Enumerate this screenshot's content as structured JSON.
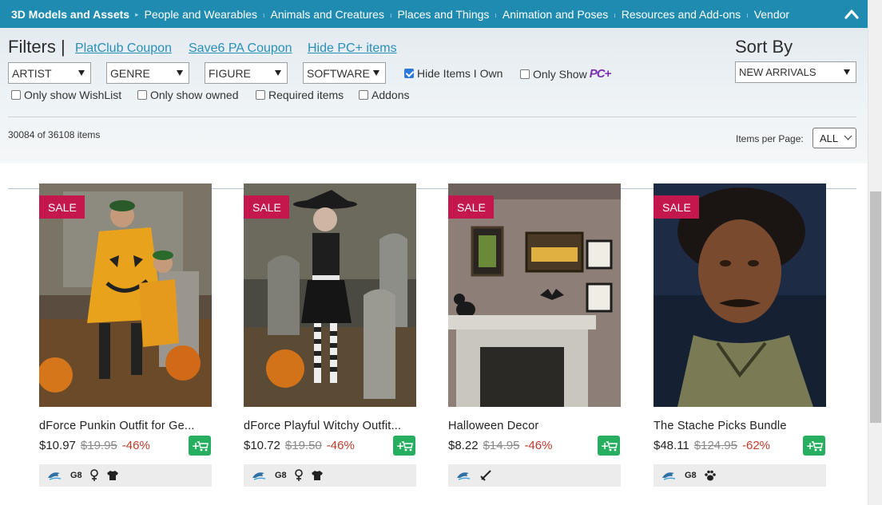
{
  "nav": {
    "items": [
      "3D Models and Assets",
      "People and Wearables",
      "Animals and Creatures",
      "Places and Things",
      "Animation and Poses",
      "Resources and Add-ons",
      "Vendor"
    ],
    "separator": "▸",
    "collapse_icon": "chevron-up-icon"
  },
  "filters": {
    "title": "Filters |",
    "links": [
      "PlatClub Coupon",
      "Save6 PA Coupon",
      "Hide PC+ items"
    ],
    "selects": [
      "ARTIST",
      "GENRE",
      "FIGURE",
      "SOFTWARE"
    ],
    "hide_owned": {
      "label": "Hide Items I Own",
      "checked": true
    },
    "only_show": {
      "label": "Only Show",
      "badge": "PC+",
      "checked": false
    },
    "checks": [
      {
        "label": "Only show WishList",
        "checked": false
      },
      {
        "label": "Only show owned",
        "checked": false
      },
      {
        "label": "Required items",
        "checked": false
      },
      {
        "label": "Addons",
        "checked": false
      }
    ],
    "sort_label": "Sort By",
    "sort_value": "NEW ARRIVALS"
  },
  "results": {
    "count_text": "30084 of 36108 items",
    "per_page_label": "Items per Page:",
    "per_page_value": "ALL"
  },
  "colors": {
    "nav": "#1f8bb0",
    "sale": "#c3174e",
    "cart": "#27ae60",
    "link": "#2a8fb8",
    "discount": "#c0392b"
  },
  "products": [
    {
      "badge": "SALE",
      "title": "dForce Punkin Outfit for Ge...",
      "price": "$10.97",
      "old_price": "$19.95",
      "discount": "-46%",
      "tags": {
        "figure": "G8",
        "icons": [
          "daz-dolphin-icon",
          "female-icon",
          "clothing-icon"
        ]
      }
    },
    {
      "badge": "SALE",
      "title": "dForce Playful Witchy Outfit...",
      "price": "$10.72",
      "old_price": "$19.50",
      "discount": "-46%",
      "tags": {
        "figure": "G8",
        "icons": [
          "daz-dolphin-icon",
          "female-icon",
          "clothing-icon"
        ]
      }
    },
    {
      "badge": "SALE",
      "title": "Halloween Decor",
      "price": "$8.22",
      "old_price": "$14.95",
      "discount": "-46%",
      "tags": {
        "figure": "",
        "icons": [
          "daz-dolphin-icon",
          "prop-sword-icon"
        ]
      }
    },
    {
      "badge": "SALE",
      "title": "The Stache Picks Bundle",
      "price": "$48.11",
      "old_price": "$124.95",
      "discount": "-62%",
      "tags": {
        "figure": "G8",
        "icons": [
          "daz-dolphin-icon",
          "paw-icon"
        ]
      }
    }
  ]
}
